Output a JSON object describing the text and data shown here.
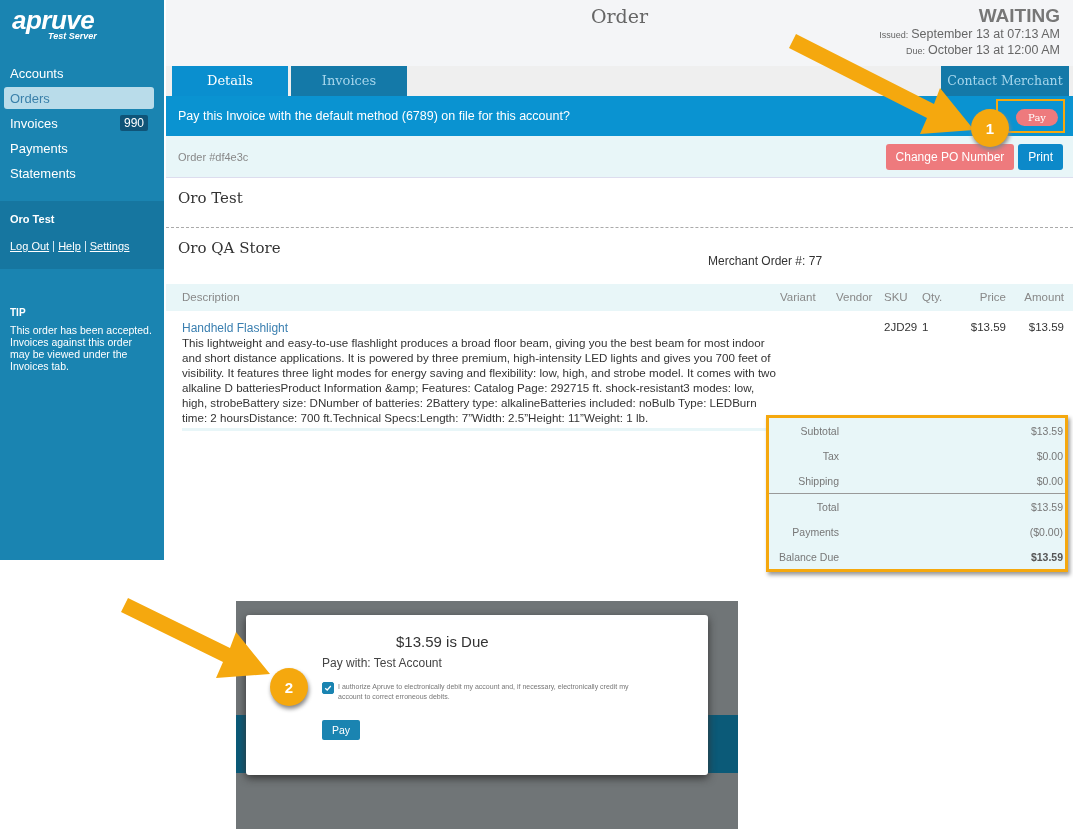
{
  "sidebar": {
    "logo": "apruve",
    "logo_subtitle": "Test Server",
    "nav": [
      {
        "label": "Accounts",
        "selected": false
      },
      {
        "label": "Orders",
        "selected": true
      },
      {
        "label": "Invoices",
        "selected": false,
        "badge": "990"
      },
      {
        "label": "Payments",
        "selected": false
      },
      {
        "label": "Statements",
        "selected": false
      }
    ],
    "user": {
      "name": "Oro Test",
      "links": [
        "Log Out",
        "Help",
        "Settings"
      ]
    },
    "tip": {
      "title": "TIP",
      "text": "This order has been accepted. Invoices against this order may be viewed under the Invoices tab."
    }
  },
  "header": {
    "title": "Order",
    "status": "WAITING",
    "issued_label": "Issued:",
    "issued": "September 13 at 07:13 AM",
    "due_label": "Due:",
    "due": "October 13 at 12:00 AM"
  },
  "tabs": [
    {
      "label": "Details",
      "selected": true
    },
    {
      "label": "Invoices",
      "selected": false
    }
  ],
  "contact_button": "Contact Merchant",
  "pay_banner": {
    "text": "Pay this Invoice with the default method (6789) on file for this account?",
    "button": "Pay"
  },
  "order_bar": {
    "order_number": "Order #df4e3c",
    "buttons": [
      {
        "label": "Change PO Number",
        "kind": "danger"
      },
      {
        "label": "Print",
        "kind": "primary"
      }
    ]
  },
  "buyer": "Oro Test",
  "merchant": "Oro QA Store",
  "merchant_order": "Merchant Order #: 77",
  "table": {
    "columns": [
      "Description",
      "Variant",
      "Vendor",
      "SKU",
      "Qty.",
      "Price",
      "Amount"
    ],
    "rows": [
      {
        "name": "Handheld Flashlight",
        "description": "This lightweight and easy-to-use flashlight produces a broad floor beam, giving you the best beam for most indoor and short distance applications. It is powered by three premium, high-intensity LED lights and gives you 700 feet of visibility. It features three light modes for energy saving and flexibility: low, high, and strobe model. It comes with two alkaline D batteriesProduct Information &amp; Features: Catalog Page: 292715 ft. shock-resistant3 modes: low, high, strobeBattery size: DNumber of batteries: 2Battery type: alkalineBatteries included: noBulb Type: LEDBurn time: 2 hoursDistance: 700 ft.Technical Specs:Length: 7”Width: 2.5”Height: 11”Weight: 1 lb.",
        "sku": "2JD29",
        "qty": "1",
        "price": "$13.59",
        "amount": "$13.59"
      }
    ]
  },
  "totals": [
    {
      "label": "Subtotal",
      "value": "$13.59",
      "divider_above": false,
      "bold": false
    },
    {
      "label": "Tax",
      "value": "$0.00",
      "divider_above": false,
      "bold": false
    },
    {
      "label": "Shipping",
      "value": "$0.00",
      "divider_above": false,
      "bold": false
    },
    {
      "label": "Total",
      "value": "$13.59",
      "divider_above": true,
      "bold": false
    },
    {
      "label": "Payments",
      "value": "($0.00)",
      "divider_above": false,
      "bold": false
    },
    {
      "label": "Balance Due",
      "value": "$13.59",
      "divider_above": false,
      "bold": true
    }
  ],
  "annotations": [
    "1",
    "2"
  ],
  "dialog": {
    "title": "$13.59 is Due",
    "pay_with": "Pay with: Test Account",
    "authorize": {
      "checked": true,
      "text": "I authorize Apruve to electronically debit my account and, if necessary, electronically credit my account to correct erroneous debits."
    },
    "button": "Pay"
  }
}
